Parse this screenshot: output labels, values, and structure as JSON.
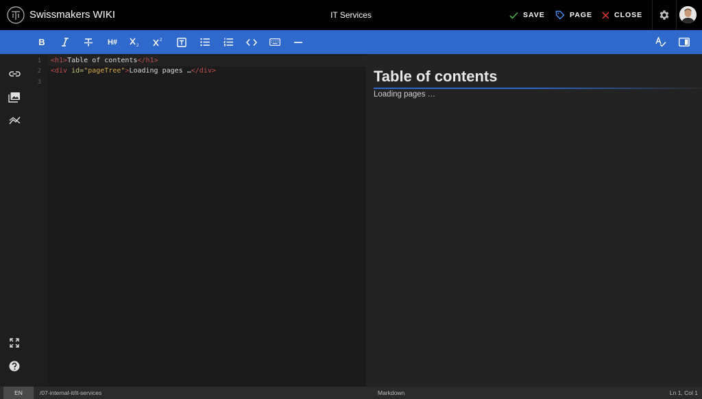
{
  "header": {
    "app_title": "Swissmakers WIKI",
    "page_title": "IT Services",
    "save_label": "SAVE",
    "page_label": "PAGE",
    "close_label": "CLOSE"
  },
  "toolbar": {
    "bold": "B",
    "heading": "H#"
  },
  "editor": {
    "line_numbers": [
      "1",
      "2",
      "3"
    ],
    "line1": {
      "open_tag": "<h1>",
      "text": "Table of contents",
      "close_tag": "</h1>"
    },
    "line2": {
      "open_tag": "<div",
      "attr": " id=",
      "value": "\"pageTree\"",
      "tag_end": ">",
      "text": "Loading pages …",
      "close_tag": "</div>"
    }
  },
  "preview": {
    "heading": "Table of contents",
    "text": "Loading pages …"
  },
  "statusbar": {
    "language": "EN",
    "path": "/07-internal-it/it-services",
    "mode": "Markdown",
    "cursor": "Ln 1, Col 1"
  },
  "colors": {
    "toolbar_bg": "#2f69cc",
    "header_bg": "#000000",
    "save_check": "#4caf50",
    "page_tag": "#4a8ff0",
    "close_x": "#e53935",
    "code_tag": "#c0504d"
  }
}
